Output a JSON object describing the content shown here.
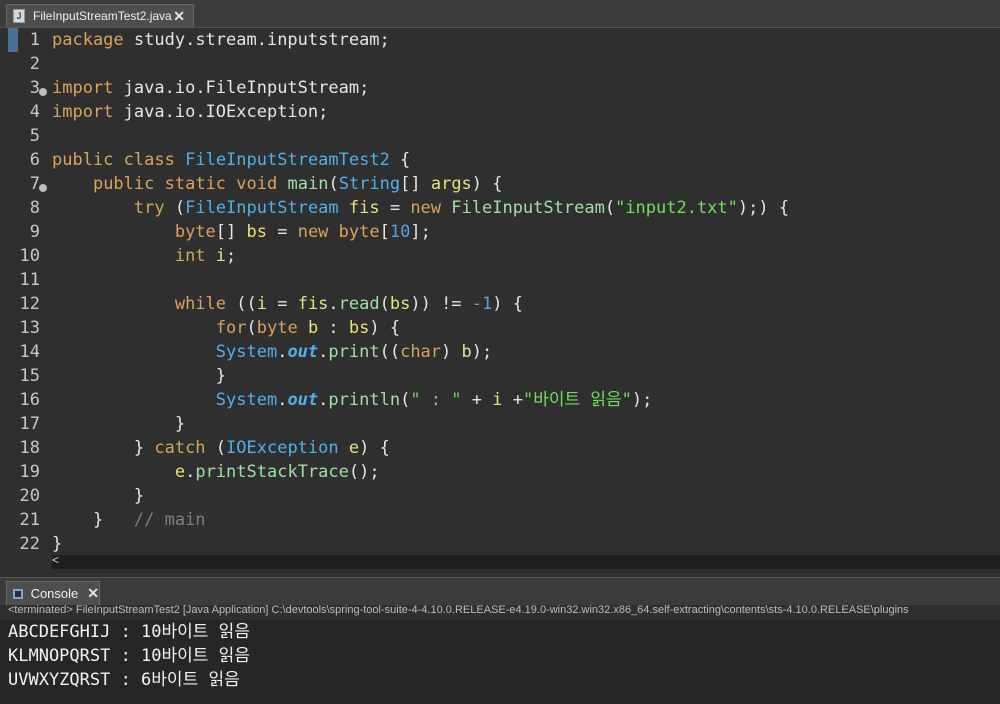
{
  "editor_tab": {
    "title": "FileInputStreamTest2.java",
    "icon": "java-file-icon",
    "close": "✕"
  },
  "lines": [
    "1",
    "2",
    "3",
    "4",
    "5",
    "6",
    "7",
    "8",
    "9",
    "10",
    "11",
    "12",
    "13",
    "14",
    "15",
    "16",
    "17",
    "18",
    "19",
    "20",
    "21",
    "22"
  ],
  "code": {
    "package_kw": "package",
    "package_name": "study.stream.inputstream;",
    "import_kw": "import",
    "import1": "java.io.FileInputStream;",
    "import2": "java.io.IOException;",
    "public_kw": "public",
    "class_kw": "class",
    "class_name": "FileInputStreamTest2",
    "static_kw": "static",
    "void_kw": "void",
    "main_name": "main",
    "string_type": "String",
    "args": "args",
    "try_kw": "try",
    "fis_type": "FileInputStream",
    "fis": "fis",
    "new_kw": "new",
    "input_file": "\"input2.txt\"",
    "byte_kw": "byte",
    "bs": "bs",
    "ten": "10",
    "int_kw": "int",
    "i": "i",
    "while_kw": "while",
    "read_call": "read",
    "minus_one": "-1",
    "for_kw": "for",
    "b": "b",
    "system": "System",
    "out": "out",
    "print": "print",
    "char_kw": "char",
    "println": "println",
    "colon_str": "\" : \"",
    "bytes_read_str": "\"바이트 읽음\"",
    "catch_kw": "catch",
    "ioexception": "IOException",
    "e": "e",
    "print_stack": "printStackTrace",
    "main_comment": "// main"
  },
  "console": {
    "tab_title": "Console",
    "close": "✕",
    "status": "<terminated> FileInputStreamTest2 [Java Application] C:\\devtools\\spring-tool-suite-4-4.10.0.RELEASE-e4.19.0-win32.win32.x86_64.self-extracting\\contents\\sts-4.10.0.RELEASE\\plugins",
    "output": [
      "ABCDEFGHIJ : 10바이트 읽음",
      "KLMNOPQRST : 10바이트 읽음",
      "UVWXYZQRST : 6바이트 읽음"
    ]
  },
  "scroll_arrow": "<"
}
